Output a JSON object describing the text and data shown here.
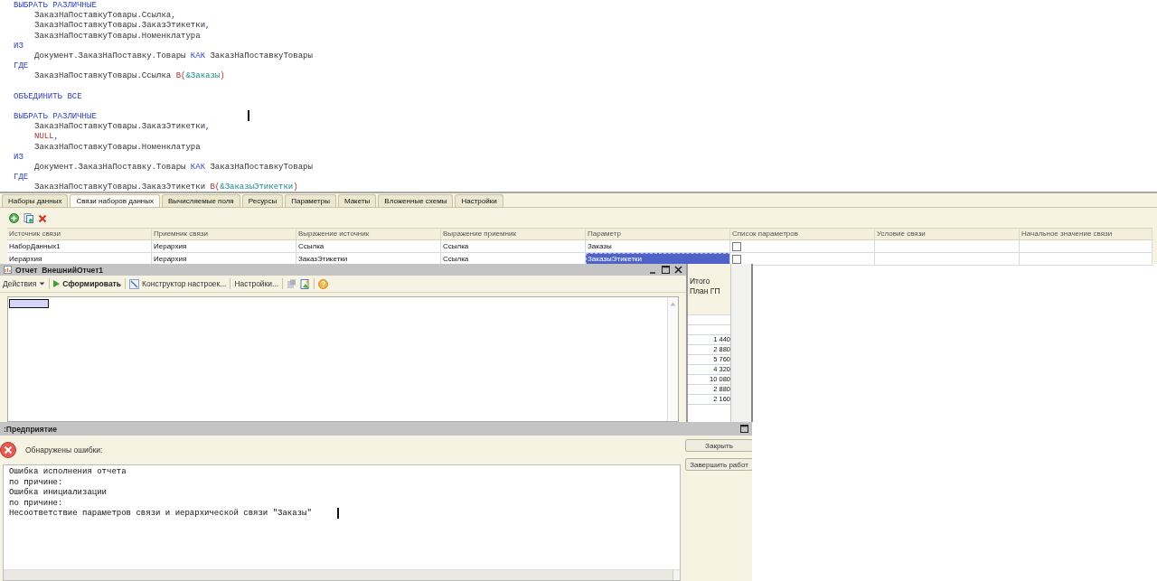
{
  "query_editor": {
    "lines": [
      {
        "kind": "code",
        "indent": false,
        "segments": [
          {
            "kind": "keyword",
            "text": "ВЫБРАТЬ РАЗЛИЧНЫЕ"
          }
        ]
      },
      {
        "kind": "code",
        "indent": true,
        "segments": [
          {
            "kind": "plain",
            "text": "ЗаказНаПоставкуТовары.Ссылка,"
          }
        ]
      },
      {
        "kind": "code",
        "indent": true,
        "segments": [
          {
            "kind": "plain",
            "text": "ЗаказНаПоставкуТовары.ЗаказЭтикетки"
          },
          {
            "kind": "keyword",
            "text": ","
          }
        ]
      },
      {
        "kind": "code",
        "indent": true,
        "segments": [
          {
            "kind": "plain",
            "text": "ЗаказНаПоставкуТовары.Номенклатура"
          }
        ]
      },
      {
        "kind": "code",
        "indent": false,
        "segments": [
          {
            "kind": "keyword",
            "text": "ИЗ"
          }
        ]
      },
      {
        "kind": "code",
        "indent": true,
        "segments": [
          {
            "kind": "plain",
            "text": "Документ.ЗаказНаПоставку.Товары "
          },
          {
            "kind": "keyword",
            "text": "КАК"
          },
          {
            "kind": "plain",
            "text": " ЗаказНаПоставкуТовары"
          }
        ]
      },
      {
        "kind": "code",
        "indent": false,
        "segments": [
          {
            "kind": "keyword",
            "text": "ГДЕ"
          }
        ]
      },
      {
        "kind": "code",
        "indent": true,
        "segments": [
          {
            "kind": "plain",
            "text": "ЗаказНаПоставкуТовары.Ссылка "
          },
          {
            "kind": "literal",
            "text": "В("
          },
          {
            "kind": "param",
            "text": "&Заказы"
          },
          {
            "kind": "literal",
            "text": ")"
          }
        ]
      },
      {
        "kind": "blank"
      },
      {
        "kind": "code",
        "indent": false,
        "segments": [
          {
            "kind": "keyword",
            "text": "ОБЪЕДИНИТЬ ВСЕ"
          }
        ]
      },
      {
        "kind": "blank"
      },
      {
        "kind": "code",
        "indent": false,
        "segments": [
          {
            "kind": "keyword",
            "text": "ВЫБРАТЬ РАЗЛИЧНЫЕ"
          }
        ]
      },
      {
        "kind": "code",
        "indent": true,
        "segments": [
          {
            "kind": "plain",
            "text": "ЗаказНаПоставкуТовары.ЗаказЭтикетки"
          },
          {
            "kind": "keyword",
            "text": ","
          }
        ]
      },
      {
        "kind": "code",
        "indent": true,
        "segments": [
          {
            "kind": "literal",
            "text": "NULL"
          },
          {
            "kind": "keyword",
            "text": ","
          }
        ]
      },
      {
        "kind": "code",
        "indent": true,
        "segments": [
          {
            "kind": "plain",
            "text": "ЗаказНаПоставкуТовары.Номенклатура"
          }
        ]
      },
      {
        "kind": "code",
        "indent": false,
        "segments": [
          {
            "kind": "keyword",
            "text": "ИЗ"
          }
        ]
      },
      {
        "kind": "code",
        "indent": true,
        "segments": [
          {
            "kind": "plain",
            "text": "Документ.ЗаказНаПоставку.Товары "
          },
          {
            "kind": "keyword",
            "text": "КАК"
          },
          {
            "kind": "plain",
            "text": " ЗаказНаПоставкуТовары"
          }
        ]
      },
      {
        "kind": "code",
        "indent": false,
        "segments": [
          {
            "kind": "keyword",
            "text": "ГДЕ"
          }
        ]
      },
      {
        "kind": "code",
        "indent": true,
        "segments": [
          {
            "kind": "plain",
            "text": "ЗаказНаПоставкуТовары.ЗаказЭтикетки "
          },
          {
            "kind": "literal",
            "text": "В("
          },
          {
            "kind": "param",
            "text": "&ЗаказыЭтикетки"
          },
          {
            "kind": "literal",
            "text": ")"
          }
        ]
      }
    ]
  },
  "tabs": [
    {
      "label": "Наборы данных",
      "selected": false
    },
    {
      "label": "Связи наборов данных",
      "selected": true
    },
    {
      "label": "Вычисляемые поля",
      "selected": false
    },
    {
      "label": "Ресурсы",
      "selected": false
    },
    {
      "label": "Параметры",
      "selected": false
    },
    {
      "label": "Макеты",
      "selected": false
    },
    {
      "label": "Вложенные схемы",
      "selected": false
    },
    {
      "label": "Настройки",
      "selected": false
    }
  ],
  "links_table": {
    "columns": [
      "Источник связи",
      "Приемник связи",
      "Выражение источник",
      "Выражение приемник",
      "Параметр",
      "Список параметров",
      "Условие связи",
      "Начальное значение связи"
    ],
    "rows": [
      {
        "selected": false,
        "cells": [
          {
            "kind": "text",
            "text": "НаборДанных1"
          },
          {
            "kind": "text",
            "text": "Иерархия"
          },
          {
            "kind": "text",
            "text": "Ссылка"
          },
          {
            "kind": "text",
            "text": "Ссылка"
          },
          {
            "kind": "text",
            "text": "Заказы"
          },
          {
            "kind": "checkbox",
            "checked": false
          },
          {
            "kind": "blank"
          },
          {
            "kind": "blank"
          }
        ]
      },
      {
        "selected": true,
        "cells": [
          {
            "kind": "text",
            "text": "Иерархия"
          },
          {
            "kind": "text",
            "text": "Иерархия"
          },
          {
            "kind": "text",
            "text": "ЗаказЭтикетки"
          },
          {
            "kind": "text",
            "text": "Ссылка"
          },
          {
            "kind": "text",
            "text": "ЗаказыЭтикетки"
          },
          {
            "kind": "checkbox",
            "checked": false
          },
          {
            "kind": "blank"
          },
          {
            "kind": "blank"
          }
        ]
      }
    ]
  },
  "report_window": {
    "title": "Отчет  ВнешнийОтчет1",
    "toolbar": [
      {
        "kind": "menu",
        "label": "Действия"
      },
      {
        "kind": "run",
        "label": "Сформировать"
      },
      {
        "kind": "designer",
        "label": "Конструктор настроек..."
      },
      {
        "kind": "plain",
        "label": "Настройки..."
      }
    ]
  },
  "background_sheet": {
    "header": [
      "Итого",
      "План ГП"
    ],
    "values": [
      "1 440",
      "2 880",
      "5 760",
      "4 320",
      "10 080",
      "2 880",
      "2 160"
    ]
  },
  "error_dialog": {
    "title": ":Предприятие",
    "message": "Обнаружены ошибки:",
    "details": [
      "Ошибка исполнения отчета",
      "по причине:",
      "Ошибка инициализации",
      "по причине:",
      "Несоответствие параметров связи и иерархической связи \"Заказы\""
    ],
    "buttons": [
      "Закрыть",
      "Завершить работ"
    ]
  }
}
